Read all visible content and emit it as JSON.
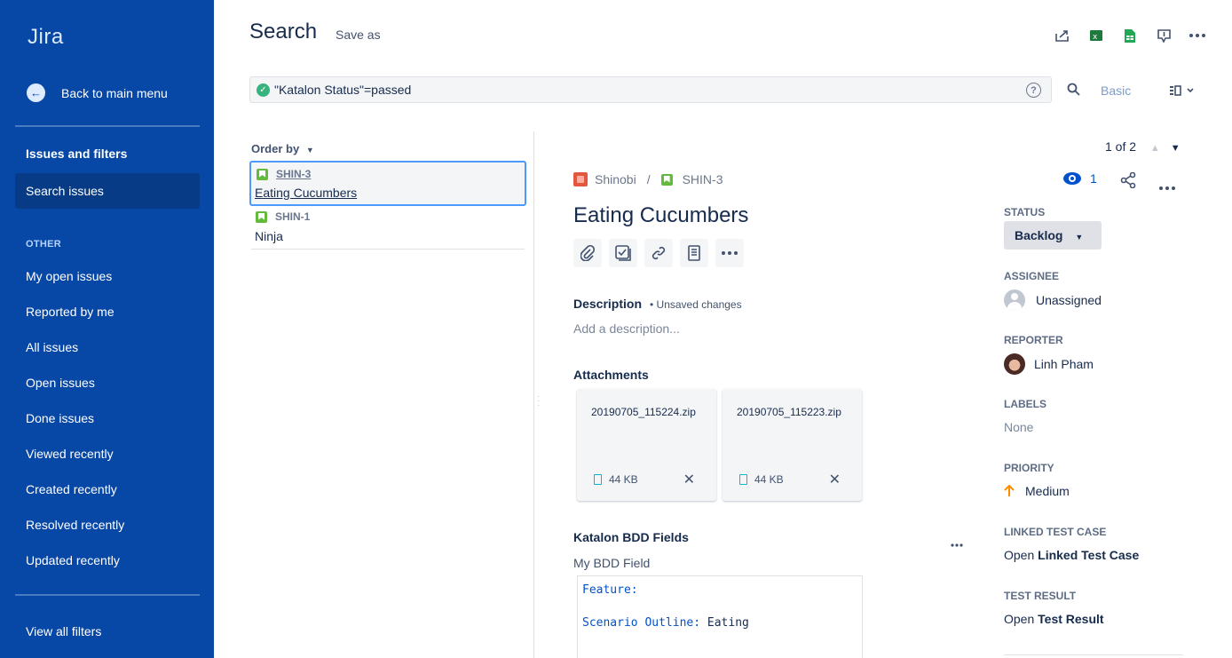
{
  "sidebar": {
    "logo": "Jira",
    "back_label": "Back to main menu",
    "section_title": "Issues and filters",
    "active_item": "Search issues",
    "other_label": "OTHER",
    "items": [
      "My open issues",
      "Reported by me",
      "All issues",
      "Open issues",
      "Done issues",
      "Viewed recently",
      "Created recently",
      "Resolved recently",
      "Updated recently"
    ],
    "view_all": "View all filters"
  },
  "header": {
    "title": "Search",
    "save_as": "Save as",
    "icons": [
      "share-icon",
      "excel-export-icon",
      "sheets-export-icon",
      "feedback-icon",
      "more-icon"
    ]
  },
  "search": {
    "query": "\"Katalon Status\"=passed",
    "mode": "Basic"
  },
  "list": {
    "order_by": "Order by",
    "issues": [
      {
        "key": "SHIN-3",
        "summary": "Eating Cucumbers"
      },
      {
        "key": "SHIN-1",
        "summary": "Ninja"
      }
    ]
  },
  "detail": {
    "pager": "1 of 2",
    "project": "Shinobi",
    "separator": "/",
    "issue_key": "SHIN-3",
    "watchers": "1",
    "title": "Eating Cucumbers",
    "description_heading": "Description",
    "unsaved": "• Unsaved changes",
    "description_placeholder": "Add a description...",
    "attachments_heading": "Attachments",
    "attachments": [
      {
        "name": "20190705_115224.zip",
        "size": "44 KB"
      },
      {
        "name": "20190705_115223.zip",
        "size": "44 KB"
      }
    ],
    "bdd_heading": "Katalon BDD Fields",
    "bdd_field_label": "My BDD Field",
    "bdd_feature_kw": "Feature:",
    "bdd_scenario_kw": "Scenario Outline:",
    "bdd_scenario_text": " Eating"
  },
  "fields": {
    "status_label": "STATUS",
    "status_value": "Backlog",
    "assignee_label": "ASSIGNEE",
    "assignee_value": "Unassigned",
    "reporter_label": "REPORTER",
    "reporter_value": "Linh Pham",
    "labels_label": "LABELS",
    "labels_value": "None",
    "priority_label": "PRIORITY",
    "priority_value": "Medium",
    "linked_label": "LINKED TEST CASE",
    "linked_prefix": "Open",
    "linked_value": "Linked Test Case",
    "result_label": "TEST RESULT",
    "result_prefix": "Open",
    "result_value": "Test Result"
  },
  "colors": {
    "sidebar": "#0747A6",
    "accent": "#0052CC",
    "story": "#63BA3C",
    "priority_medium": "#FF8B00"
  }
}
